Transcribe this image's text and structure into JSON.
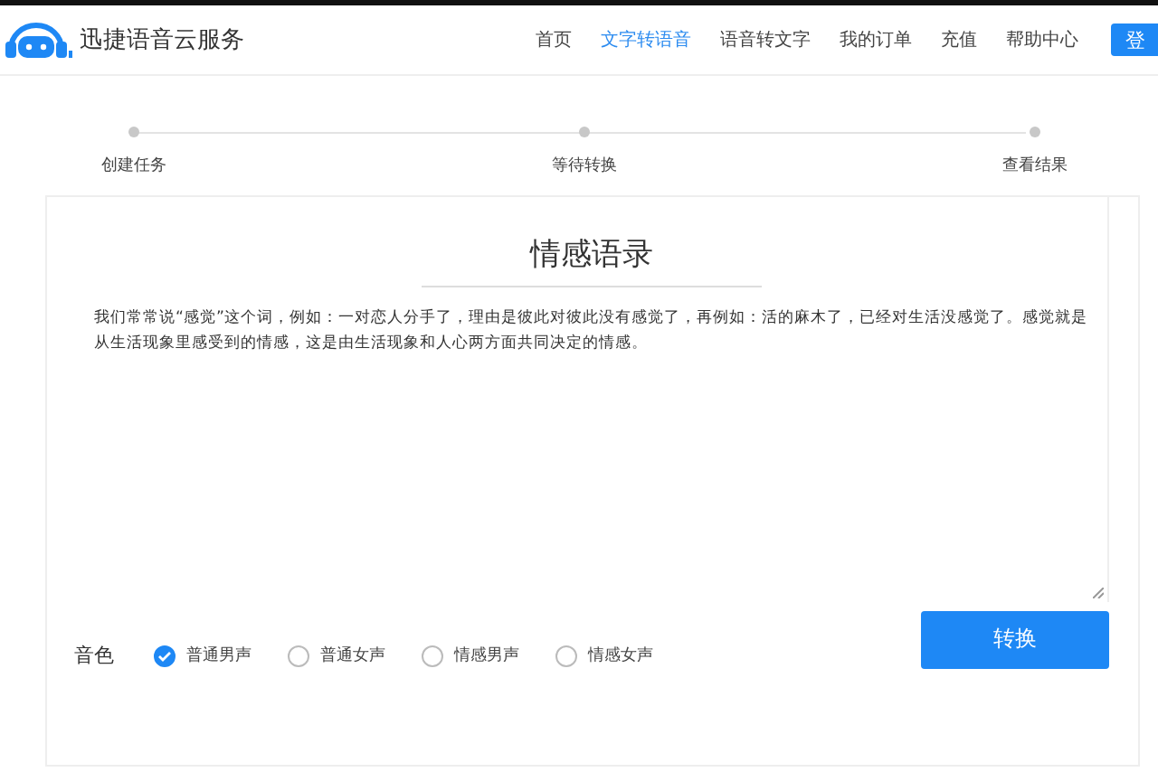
{
  "header": {
    "brand": "迅捷语音云服务",
    "nav": [
      {
        "label": "首页",
        "selected": false
      },
      {
        "label": "文字转语音",
        "selected": true
      },
      {
        "label": "语音转文字",
        "selected": false
      },
      {
        "label": "我的订单",
        "selected": false
      },
      {
        "label": "充值",
        "selected": false
      },
      {
        "label": "帮助中心",
        "selected": false
      }
    ],
    "login_button": "登"
  },
  "steps": [
    "创建任务",
    "等待转换",
    "查看结果"
  ],
  "editor": {
    "title": "情感语录",
    "text": "我们常常说“感觉”这个词，例如：一对恋人分手了，理由是彼此对彼此没有感觉了，再例如：活的麻木了，已经对生活没感觉了。感觉就是从生活现象里感受到的情感，这是由生活现象和人心两方面共同决定的情感。"
  },
  "voice": {
    "label": "音色",
    "options": [
      {
        "label": "普通男声",
        "selected": true
      },
      {
        "label": "普通女声",
        "selected": false
      },
      {
        "label": "情感男声",
        "selected": false
      },
      {
        "label": "情感女声",
        "selected": false
      }
    ]
  },
  "convert_button": "转换"
}
